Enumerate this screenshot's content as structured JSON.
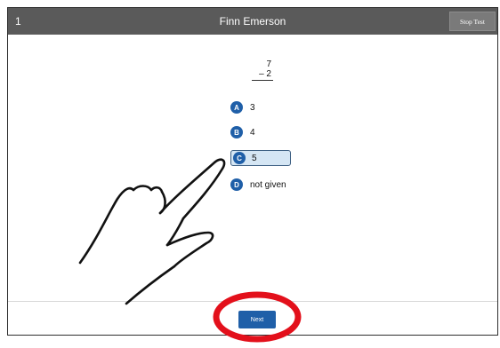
{
  "header": {
    "question_number": "1",
    "student_name": "Finn Emerson",
    "stop_label": "Stop Test"
  },
  "problem": {
    "top": "7",
    "bottom": "– 2"
  },
  "choices": [
    {
      "letter": "A",
      "text": "3"
    },
    {
      "letter": "B",
      "text": "4"
    },
    {
      "letter": "C",
      "text": "5"
    },
    {
      "letter": "D",
      "text": "not given"
    }
  ],
  "selected_choice": "C",
  "footer": {
    "next_label": "Next"
  },
  "colors": {
    "header_bg": "#5a5a5a",
    "accent_blue": "#1f5fa8",
    "selected_bg": "#d5e6f4",
    "annotation_red": "#e3101b"
  },
  "annotations": [
    "pointing-hand-icon",
    "red-circle-highlight"
  ]
}
